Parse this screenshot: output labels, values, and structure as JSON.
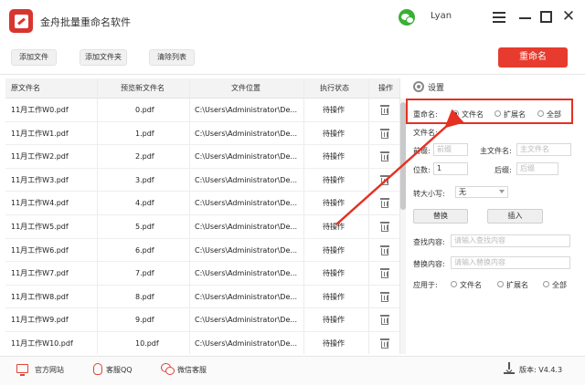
{
  "window": {
    "title": "金舟批量重命名软件",
    "username": "Lyan"
  },
  "toolbar": {
    "add_file": "添加文件",
    "add_folder": "添加文件夹",
    "clear_list": "清除列表",
    "rename": "重命名"
  },
  "table": {
    "headers": [
      "原文件名",
      "预览新文件名",
      "文件位置",
      "执行状态",
      "操作"
    ],
    "rows": [
      {
        "original": "11月工作W0.pdf",
        "preview": "0.pdf",
        "location": "C:\\Users\\Administrator\\De...",
        "status": "待操作"
      },
      {
        "original": "11月工作W1.pdf",
        "preview": "1.pdf",
        "location": "C:\\Users\\Administrator\\De...",
        "status": "待操作"
      },
      {
        "original": "11月工作W2.pdf",
        "preview": "2.pdf",
        "location": "C:\\Users\\Administrator\\De...",
        "status": "待操作"
      },
      {
        "original": "11月工作W3.pdf",
        "preview": "3.pdf",
        "location": "C:\\Users\\Administrator\\De...",
        "status": "待操作"
      },
      {
        "original": "11月工作W4.pdf",
        "preview": "4.pdf",
        "location": "C:\\Users\\Administrator\\De...",
        "status": "待操作"
      },
      {
        "original": "11月工作W5.pdf",
        "preview": "5.pdf",
        "location": "C:\\Users\\Administrator\\De...",
        "status": "待操作"
      },
      {
        "original": "11月工作W6.pdf",
        "preview": "6.pdf",
        "location": "C:\\Users\\Administrator\\De...",
        "status": "待操作"
      },
      {
        "original": "11月工作W7.pdf",
        "preview": "7.pdf",
        "location": "C:\\Users\\Administrator\\De...",
        "status": "待操作"
      },
      {
        "original": "11月工作W8.pdf",
        "preview": "8.pdf",
        "location": "C:\\Users\\Administrator\\De...",
        "status": "待操作"
      },
      {
        "original": "11月工作W9.pdf",
        "preview": "9.pdf",
        "location": "C:\\Users\\Administrator\\De...",
        "status": "待操作"
      },
      {
        "original": "11月工作W10.pdf",
        "preview": "10.pdf",
        "location": "C:\\Users\\Administrator\\De...",
        "status": "待操作"
      }
    ]
  },
  "settings": {
    "title": "设置",
    "rename_label": "重命名:",
    "rename_options": [
      "文件名",
      "扩展名",
      "全部"
    ],
    "filename_label": "文件名:",
    "prefix_label": "前缀:",
    "prefix_placeholder": "前缀",
    "mainname_label": "主文件名:",
    "mainname_placeholder": "主文件名",
    "digits_label": "位数:",
    "digits_value": "1",
    "suffix_label": "后缀:",
    "suffix_placeholder": "后缀",
    "case_label": "转大小写:",
    "case_value": "无",
    "replace_button": "替换",
    "insert_button": "插入",
    "find_label": "查找内容:",
    "find_placeholder": "请输入查找内容",
    "replace_label": "替换内容:",
    "replace_placeholder": "请输入替换内容",
    "apply_label": "应用于:",
    "apply_options": [
      "文件名",
      "扩展名",
      "全部"
    ]
  },
  "footer": {
    "website": "官方网站",
    "qq": "客服QQ",
    "wechat": "微信客服",
    "version": "版本: V4.4.3"
  },
  "colors": {
    "accent": "#e63b2e",
    "highlight": "#e53022"
  }
}
